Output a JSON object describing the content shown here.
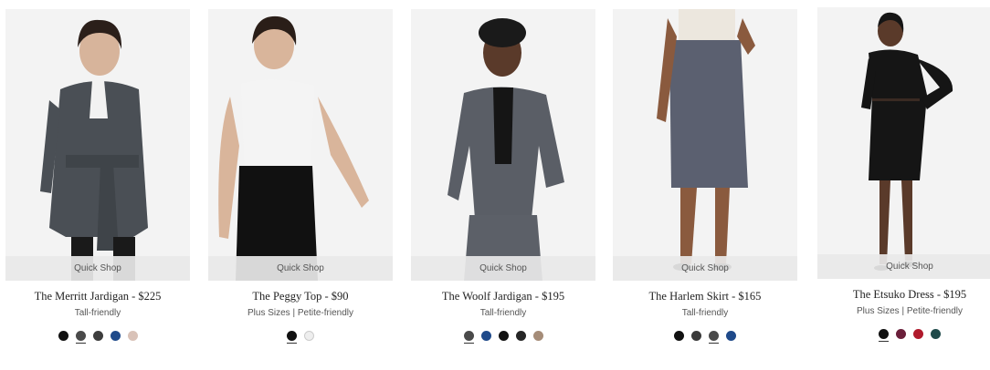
{
  "quick_shop_label": "Quick Shop",
  "products": [
    {
      "title": "The Merritt Jardigan - $225",
      "subtitle": "Tall-friendly",
      "swatches": [
        "#111111",
        "#4a4a4a",
        "#3d3d3d",
        "#1f4a8a",
        "#d9c2b8"
      ],
      "selected_swatch": 1
    },
    {
      "title": "The Peggy Top - $90",
      "subtitle": "Plus Sizes | Petite-friendly",
      "swatches": [
        "#111111",
        "#eeeeee"
      ],
      "selected_swatch": 0
    },
    {
      "title": "The Woolf Jardigan - $195",
      "subtitle": "Tall-friendly",
      "swatches": [
        "#4a4a4a",
        "#1f4a8a",
        "#111111",
        "#262626",
        "#a58c78"
      ],
      "selected_swatch": 0
    },
    {
      "title": "The Harlem Skirt - $165",
      "subtitle": "Tall-friendly",
      "swatches": [
        "#111111",
        "#3a3a3a",
        "#4a4a4a",
        "#1f4a8a"
      ],
      "selected_swatch": 2
    },
    {
      "title": "The Etsuko Dress - $195",
      "subtitle": "Plus Sizes | Petite-friendly",
      "swatches": [
        "#111111",
        "#6a1f3a",
        "#b01a2c",
        "#1f4a4a"
      ],
      "selected_swatch": 0
    }
  ]
}
